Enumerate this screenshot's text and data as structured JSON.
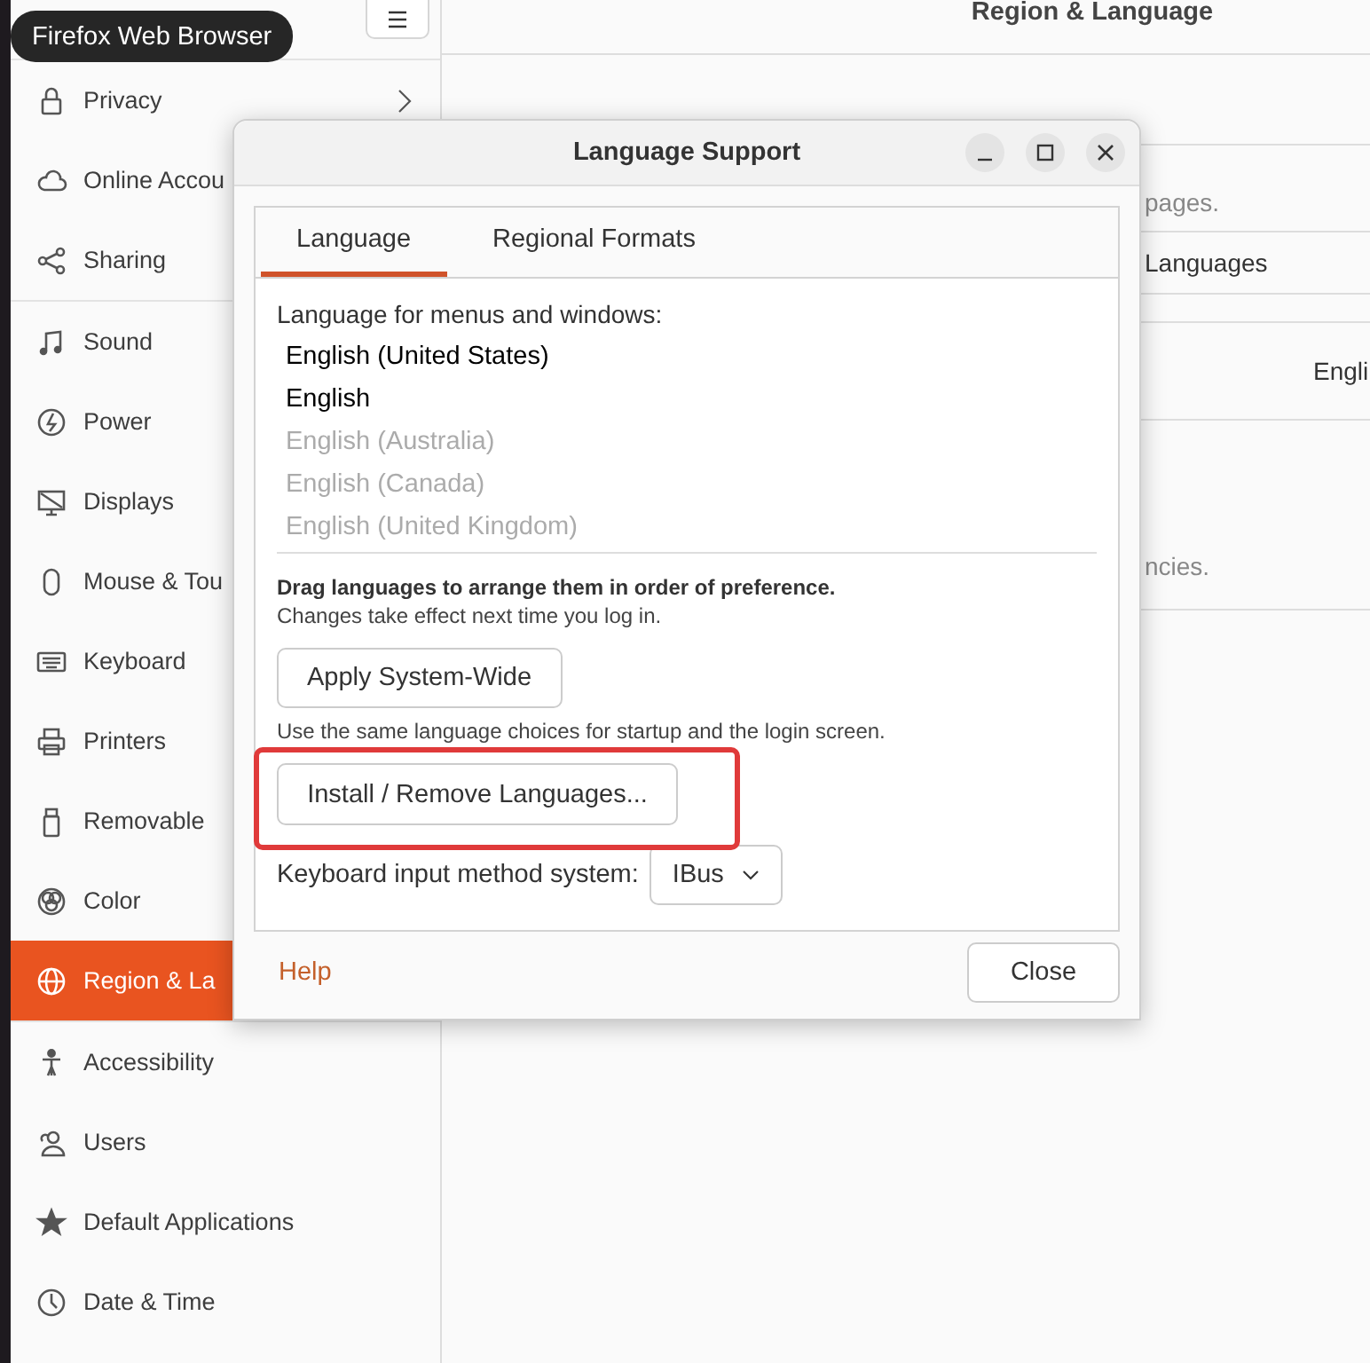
{
  "tooltip": {
    "text": "Firefox Web Browser"
  },
  "sidebar": {
    "items": [
      {
        "label": "Privacy",
        "selected": false,
        "submenu": true
      },
      {
        "label": "Online Accou",
        "selected": false,
        "submenu": false
      },
      {
        "label": "Sharing",
        "selected": false,
        "submenu": false
      },
      {
        "label": "Sound",
        "selected": false,
        "submenu": false
      },
      {
        "label": "Power",
        "selected": false,
        "submenu": false
      },
      {
        "label": "Displays",
        "selected": false,
        "submenu": false
      },
      {
        "label": "Mouse & Tou",
        "selected": false,
        "submenu": false
      },
      {
        "label": "Keyboard",
        "selected": false,
        "submenu": false
      },
      {
        "label": "Printers",
        "selected": false,
        "submenu": false
      },
      {
        "label": "Removable",
        "selected": false,
        "submenu": false
      },
      {
        "label": "Color",
        "selected": false,
        "submenu": false
      },
      {
        "label": "Region & La",
        "selected": true,
        "submenu": false
      },
      {
        "label": "Accessibility",
        "selected": false,
        "submenu": false
      },
      {
        "label": "Users",
        "selected": false,
        "submenu": false
      },
      {
        "label": "Default Applications",
        "selected": false,
        "submenu": false
      },
      {
        "label": "Date & Time",
        "selected": false,
        "submenu": false
      }
    ]
  },
  "main": {
    "title": "Region & Language",
    "rows": [
      {
        "kind": "description",
        "text": "pages."
      },
      {
        "kind": "label",
        "text": "Languages"
      },
      {
        "kind": "value",
        "text": "Engli"
      },
      {
        "kind": "description",
        "text": "ncies."
      }
    ]
  },
  "dialog": {
    "title": "Language Support",
    "tabs": [
      {
        "label": "Language",
        "selected": true
      },
      {
        "label": "Regional Formats",
        "selected": false
      }
    ],
    "list_label": "Language for menus and windows:",
    "languages": [
      {
        "label": "English (United States)",
        "dimmed": false
      },
      {
        "label": "English",
        "dimmed": false
      },
      {
        "label": "English (Australia)",
        "dimmed": true
      },
      {
        "label": "English (Canada)",
        "dimmed": true
      },
      {
        "label": "English (United Kingdom)",
        "dimmed": true
      }
    ],
    "drag_hint": "Drag languages to arrange them in order of preference.",
    "drag_note": "Changes take effect next time you log in.",
    "apply_button": "Apply System-Wide",
    "apply_note": "Use the same language choices for startup and the login screen.",
    "install_button": "Install / Remove Languages...",
    "keyboard": {
      "label": "Keyboard input method system:",
      "value": "IBus"
    },
    "help": "Help",
    "close_button": "Close"
  }
}
